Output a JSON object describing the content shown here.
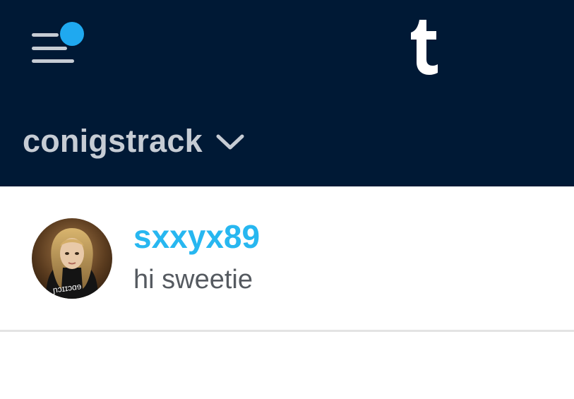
{
  "header": {
    "menu_icon": "hamburger-menu-icon",
    "notification_dot_color": "#1fa9f0",
    "logo_icon": "tumblr-logo-icon",
    "background_color": "#001935"
  },
  "blog_switcher": {
    "blog_name": "conigstrack",
    "chevron_icon": "chevron-down-icon"
  },
  "conversations": [
    {
      "username": "sxxyx89",
      "preview": "hi sweetie",
      "avatar_icon": "user-avatar"
    }
  ],
  "accent_color": "#27b7f0"
}
